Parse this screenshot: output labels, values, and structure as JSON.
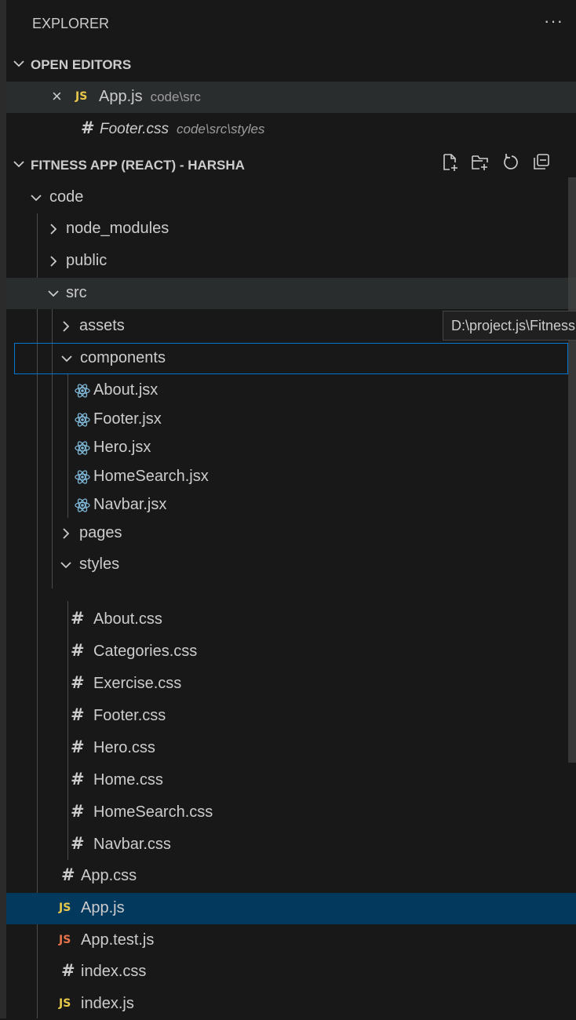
{
  "explorer": {
    "title": "EXPLORER",
    "more_label": "···"
  },
  "open_editors": {
    "title": "OPEN EDITORS",
    "items": [
      {
        "icon": "js",
        "name": "App.js",
        "path": "code\\src",
        "close": "×"
      },
      {
        "icon": "css",
        "name": "Footer.css",
        "path": "code\\src\\styles"
      }
    ]
  },
  "project": {
    "title": "FITNESS APP (REACT) - HARSHA",
    "toolbar": [
      "new-file-icon",
      "new-folder-icon",
      "refresh-icon",
      "collapse-all-icon"
    ]
  },
  "tree": {
    "code": "code",
    "node_modules": "node_modules",
    "public": "public",
    "src": "src",
    "assets": "assets",
    "components": "components",
    "component_files": [
      "About.jsx",
      "Footer.jsx",
      "Hero.jsx",
      "HomeSearch.jsx",
      "Navbar.jsx"
    ],
    "pages": "pages",
    "styles": "styles",
    "style_files": [
      "About.css",
      "Categories.css",
      "Exercise.css",
      "Footer.css",
      "Hero.css",
      "Home.css",
      "HomeSearch.css",
      "Navbar.css"
    ],
    "src_files": [
      {
        "icon": "css",
        "name": "App.css"
      },
      {
        "icon": "js",
        "name": "App.js"
      },
      {
        "icon": "js-test",
        "name": "App.test.js"
      },
      {
        "icon": "css",
        "name": "index.css"
      },
      {
        "icon": "js",
        "name": "index.js"
      }
    ]
  },
  "tooltip": {
    "text": "D:\\project.js\\Fitness"
  },
  "icons": {
    "js_label": "JS",
    "css_label": "#"
  },
  "colors": {
    "selection": "#04395e",
    "focus_border": "#0078d4",
    "js": "#e8c84a",
    "js_test": "#e8734a",
    "react": "#7fb8d8"
  }
}
